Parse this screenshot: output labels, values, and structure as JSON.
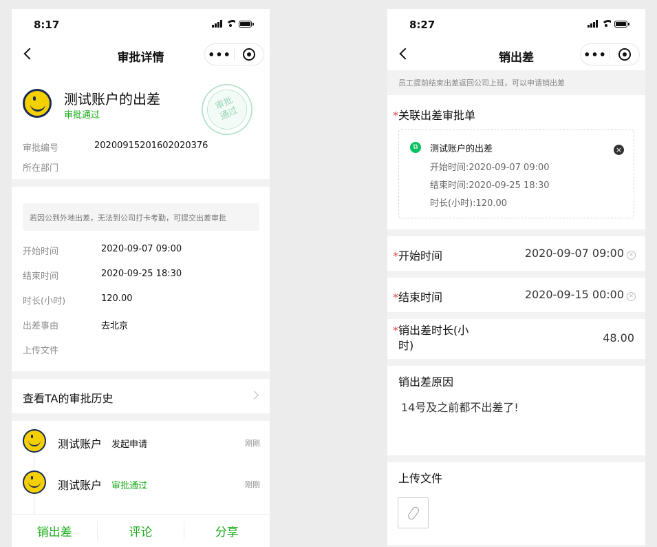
{
  "left": {
    "status": {
      "time": "8:17"
    },
    "nav": {
      "title": "审批详情",
      "more": "•••"
    },
    "header": {
      "title": "测试账户的出差",
      "status": "审批通过",
      "stamp_line1": "审批",
      "stamp_line2": "通过",
      "approval_no_label": "审批编号",
      "approval_no": "20200915201602020376",
      "dept_label": "所在部门",
      "dept": ""
    },
    "notice": "若因公到外地出差，无法到公司打卡考勤，可提交出差审批",
    "details": [
      {
        "label": "开始时间",
        "value": "2020-09-07 09:00"
      },
      {
        "label": "结束时间",
        "value": "2020-09-25 18:30"
      },
      {
        "label": "时长(小时)",
        "value": "120.00"
      },
      {
        "label": "出差事由",
        "value": "去北京"
      },
      {
        "label": "上传文件",
        "value": ""
      }
    ],
    "history_link": "查看TA的审批历史",
    "history": [
      {
        "name": "测试账户",
        "action": "发起申请",
        "time": "刚刚"
      },
      {
        "name": "测试账户",
        "action": "审批通过",
        "time": "刚刚"
      }
    ],
    "actions": [
      "销出差",
      "评论",
      "分享"
    ]
  },
  "right": {
    "status": {
      "time": "8:27"
    },
    "nav": {
      "title": "销出差",
      "more": "•••"
    },
    "tip": "员工提前结束出差返回公司上班，可以申请销出差",
    "link_section": {
      "label": "关联出差审批单",
      "card_title": "测试账户的出差",
      "line1": "开始时间:2020-09-07 09:00",
      "line2": "结束时间:2020-09-25 18:30",
      "line3": "时长(小时):120.00"
    },
    "start_label": "开始时间",
    "start_value": "2020-09-07 09:00",
    "end_label": "结束时间",
    "end_value": "2020-09-15 00:00",
    "duration_label_1": "销出差时长(小",
    "duration_label_2": "时)",
    "duration_value": "48.00",
    "reason_label": "销出差原因",
    "reason_value": "14号及之前都不出差了!",
    "upload_label": "上传文件"
  },
  "colors": {
    "accent": "#1aad19",
    "required": "#e64340",
    "background": "#ececec"
  }
}
